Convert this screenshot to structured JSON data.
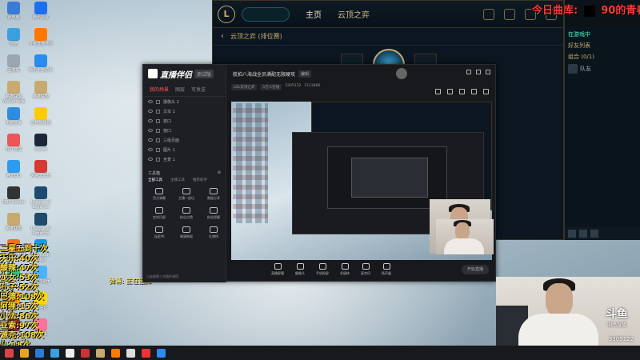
{
  "desktop": {
    "icons": [
      {
        "label": "此电脑",
        "color": "#3a7bd5"
      },
      {
        "label": "网络",
        "color": "#3aa0e0"
      },
      {
        "label": "回收站",
        "color": "#9aa7b0"
      },
      {
        "label": "英雄联盟WeGame版",
        "color": "#c8aa6e"
      },
      {
        "label": "电脑管家",
        "color": "#2f8ce0"
      },
      {
        "label": "软件管理",
        "color": "#e55"
      },
      {
        "label": "腾讯QQ",
        "color": "#2b9cf0"
      },
      {
        "label": "OBS Studio",
        "color": "#333"
      },
      {
        "label": "英雄联盟",
        "color": "#c8aa6e"
      },
      {
        "label": "火绒安全软件",
        "color": "#f36c21"
      },
      {
        "label": "QQ音乐",
        "color": "#31c27c"
      },
      {
        "label": "QQ游戏",
        "color": "#ff9a00"
      },
      {
        "label": "Slay the Spire",
        "color": "#8a2b2b"
      },
      {
        "label": "腾讯会议",
        "color": "#1c6ff0"
      },
      {
        "label": "斗鱼直播伴侣",
        "color": "#ff7700"
      },
      {
        "label": "腾讯手游助手",
        "color": "#2a8bf2"
      },
      {
        "label": "英雄联盟",
        "color": "#c8aa6e"
      },
      {
        "label": "雷神加速器",
        "color": "#ffcc00"
      },
      {
        "label": "Steam",
        "color": "#1b2838"
      },
      {
        "label": "网易云音乐",
        "color": "#d43c33"
      },
      {
        "label": "League of Legends",
        "color": "#1e4a6b"
      },
      {
        "label": "League of Legends",
        "color": "#1e4a6b"
      },
      {
        "label": "Microsoft Edge",
        "color": "#1a9be0"
      },
      {
        "label": "UU加速器",
        "color": "#4db2ff"
      },
      {
        "label": "YY语音",
        "color": "#ffd400"
      },
      {
        "label": "Bilibili",
        "color": "#fb7299"
      }
    ]
  },
  "ranking": {
    "rows": [
      {
        "name": "二星五到十次",
        "count": ""
      },
      {
        "name": "天乐:",
        "count": "40次"
      },
      {
        "name": "酸辣:",
        "count": "47次"
      },
      {
        "name": "龙女:",
        "count": "53次"
      },
      {
        "name": "孔子:",
        "count": "52次"
      },
      {
        "name": "巴德:",
        "count": "108次"
      },
      {
        "name": "阿狸:",
        "count": "15次"
      },
      {
        "name": "小法:",
        "count": "86次"
      },
      {
        "name": "亚索:",
        "count": "97次"
      },
      {
        "name": "源克:",
        "count": "108次"
      },
      {
        "name": "八:",
        "count": "18次"
      }
    ]
  },
  "stream_title": {
    "left": "今日曲库:",
    "right": "90的青春"
  },
  "lol": {
    "nav_home": "主页",
    "nav_tft": "云顶之弈",
    "subtitle": "云顶之弈 (排位赛)",
    "social": {
      "user_status": "在游戏中",
      "friends_title": "好友列表",
      "group": "组合 (0/1)",
      "friend_name": "队友"
    }
  },
  "helper": {
    "brand": "直播伴侣",
    "version": "测试版",
    "tabs": [
      "我的场景",
      "图层",
      "可发送"
    ],
    "scenes": [
      "摄像头 2",
      "文本 1",
      "窗口",
      "窗口",
      "三级页面",
      "图片 1",
      "全景 1"
    ],
    "tools_title": "工具箱",
    "tools_tabs": [
      "全部工具",
      "主播工具",
      "推荐助手"
    ],
    "tools": [
      "官方弹幕",
      "主播一起玩",
      "数据分享",
      "定时闪屏",
      "粉丝点赞",
      "粉丝提醒",
      "连麦PK",
      "健康数据",
      "礼物榜"
    ],
    "bottom_tip": "已连接第三方插件调用",
    "room_title": "航拍八海战全员满配无限硬攻",
    "room_tag": "编辑",
    "sub_chips": [
      "LOL云顶之弈",
      "5万人在线"
    ],
    "sub_viewers": "3305122",
    "sub_heat": "1113886",
    "controls": [
      "直播屏幕",
      "摄像头",
      "手机投屏",
      "多媒体",
      "麦克风",
      "扬声器"
    ],
    "start_button": "开始直播"
  },
  "watermark": {
    "logo": "斗鱼",
    "logo_sub": "国民直播",
    "room_id": "3305122"
  },
  "mid_caption": "弹幕: 正在选择"
}
